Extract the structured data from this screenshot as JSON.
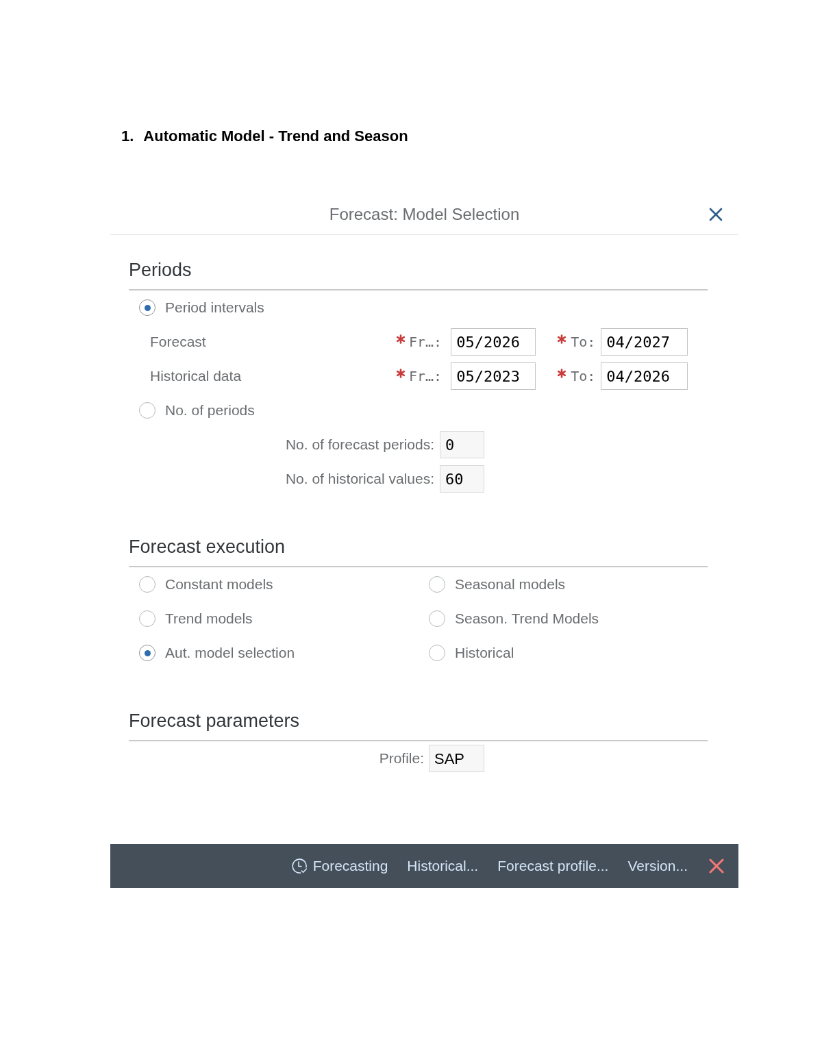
{
  "heading": {
    "number": "1.",
    "text": "Automatic Model - Trend and Season"
  },
  "dialog": {
    "title": "Forecast: Model Selection",
    "sections": [
      {
        "kind": "periods",
        "title": "Periods",
        "options": [
          {
            "kind": "intervals",
            "label": "Period intervals",
            "selected": true,
            "rows": [
              {
                "label": "Forecast",
                "from": {
                  "label": "Fr…:",
                  "value": "05/2026",
                  "required": true
                },
                "to": {
                  "label": "To:",
                  "value": "04/2027",
                  "required": true
                }
              },
              {
                "label": "Historical data",
                "from": {
                  "label": "Fr…:",
                  "value": "05/2023",
                  "required": true
                },
                "to": {
                  "label": "To:",
                  "value": "04/2026",
                  "required": true
                }
              }
            ]
          },
          {
            "kind": "counts",
            "label": "No. of periods",
            "selected": false,
            "fields": [
              {
                "label": "No. of forecast periods:",
                "value": "0"
              },
              {
                "label": "No. of historical values:",
                "value": "60"
              }
            ]
          }
        ]
      },
      {
        "kind": "execution",
        "title": "Forecast execution",
        "options": [
          {
            "label": "Constant models",
            "selected": false
          },
          {
            "label": "Seasonal models",
            "selected": false
          },
          {
            "label": "Trend models",
            "selected": false
          },
          {
            "label": "Season. Trend Models",
            "selected": false
          },
          {
            "label": "Aut. model selection",
            "selected": true
          },
          {
            "label": "Historical",
            "selected": false
          }
        ]
      },
      {
        "kind": "parameters",
        "title": "Forecast parameters",
        "fields": [
          {
            "label": "Profile:",
            "value": "SAP"
          }
        ]
      }
    ],
    "footer": {
      "buttons": [
        {
          "kind": "icon",
          "label": "Forecasting"
        },
        {
          "kind": "text",
          "label": "Historical..."
        },
        {
          "kind": "text",
          "label": "Forecast profile..."
        },
        {
          "kind": "text",
          "label": "Version..."
        }
      ]
    }
  }
}
